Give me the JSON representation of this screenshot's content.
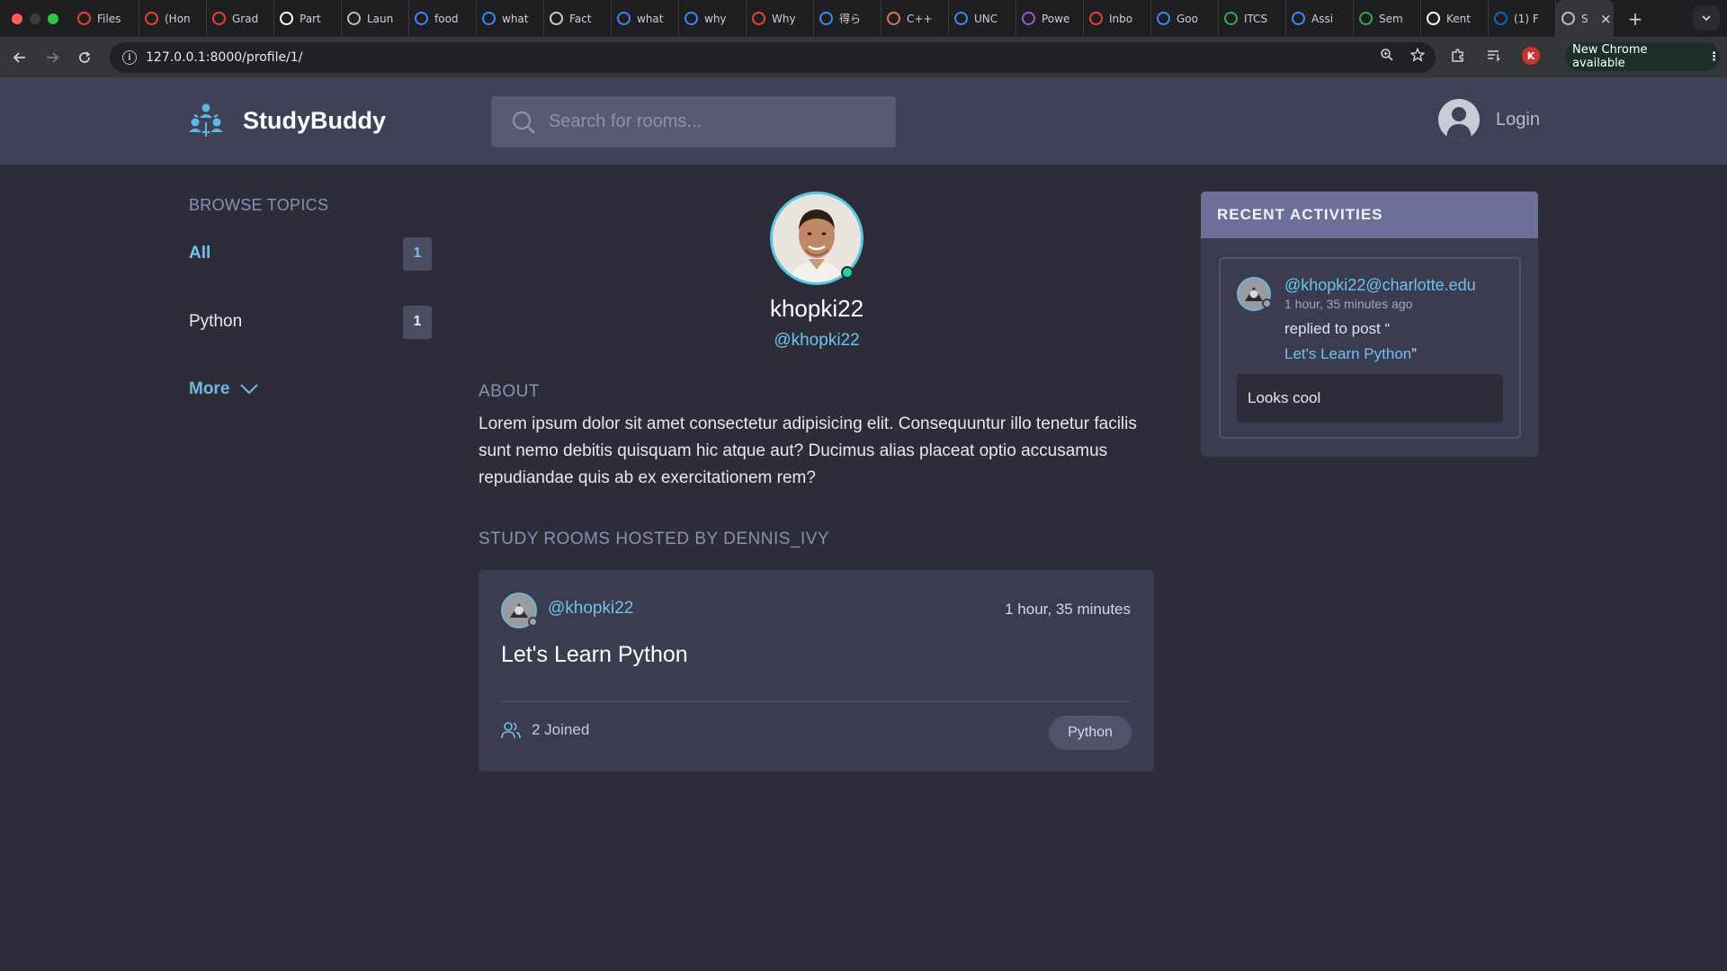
{
  "browser": {
    "tabs": [
      {
        "title": "Files",
        "icon": "loading-icon",
        "color": "#e94235"
      },
      {
        "title": "(Hon",
        "icon": "loading-icon",
        "color": "#e94235"
      },
      {
        "title": "Grad",
        "icon": "loading-icon",
        "color": "#e94235"
      },
      {
        "title": "Part",
        "icon": "github-icon",
        "color": "#ffffff"
      },
      {
        "title": "Laun",
        "icon": "globe-icon",
        "color": "#bdbdbd"
      },
      {
        "title": "food",
        "icon": "google-icon",
        "color": "#4285f4"
      },
      {
        "title": "what",
        "icon": "google-icon",
        "color": "#4285f4"
      },
      {
        "title": "Fact",
        "icon": "news-icon",
        "color": "#cccccc"
      },
      {
        "title": "what",
        "icon": "google-icon",
        "color": "#4285f4"
      },
      {
        "title": "why",
        "icon": "google-icon",
        "color": "#4285f4"
      },
      {
        "title": "Why",
        "icon": "star-icon",
        "color": "#e94235"
      },
      {
        "title": "得ら",
        "icon": "google-icon",
        "color": "#4285f4"
      },
      {
        "title": "C++",
        "icon": "claude-icon",
        "color": "#d97757"
      },
      {
        "title": "UNC",
        "icon": "calendar-icon",
        "color": "#4285f4"
      },
      {
        "title": "Powe",
        "icon": "copilot-icon",
        "color": "#9b59d0"
      },
      {
        "title": "Inbo",
        "icon": "gmail-icon",
        "color": "#ea4335"
      },
      {
        "title": "Goo",
        "icon": "translate-icon",
        "color": "#4285f4"
      },
      {
        "title": "ITCS",
        "icon": "drive-icon",
        "color": "#34a853"
      },
      {
        "title": "Assi",
        "icon": "docs-icon",
        "color": "#4285f4"
      },
      {
        "title": "Sem",
        "icon": "sheets-icon",
        "color": "#34a853"
      },
      {
        "title": "Kent",
        "icon": "github-icon",
        "color": "#ffffff"
      },
      {
        "title": "(1) F",
        "icon": "linkedin-icon",
        "color": "#0a66c2"
      }
    ],
    "active_tab": {
      "title": "S",
      "icon": "globe-icon"
    },
    "url": "127.0.0.1:8000/profile/1/",
    "profile_initial": "K",
    "update_label": "New Chrome available"
  },
  "header": {
    "brand": "StudyBuddy",
    "search_placeholder": "Search for rooms...",
    "login_label": "Login"
  },
  "sidebar": {
    "title": "BROWSE TOPICS",
    "topics": [
      {
        "name": "All",
        "count": "1"
      },
      {
        "name": "Python",
        "count": "1"
      }
    ],
    "more_label": "More"
  },
  "profile": {
    "name": "khopki22",
    "handle": "@khopki22",
    "about_label": "ABOUT",
    "about_text": "Lorem ipsum dolor sit amet consectetur adipisicing elit. Consequuntur illo tenetur facilis sunt nemo debitis quisquam hic atque aut? Ducimus alias placeat optio accusamus repudiandae quis ab ex exercitationem rem?",
    "rooms_label": "STUDY ROOMS HOSTED BY DENNIS_IVY"
  },
  "room": {
    "host": "@khopki22",
    "time": "1 hour, 35 minutes",
    "title": "Let's Learn Python",
    "joined": "2 Joined",
    "topic": "Python"
  },
  "activities": {
    "title": "RECENT ACTIVITIES",
    "items": [
      {
        "user": "@khopki22@charlotte.edu",
        "time": "1 hour, 35 minutes ago",
        "action_prefix": "replied to post “",
        "post_title": "Let's Learn Python",
        "action_suffix": "”",
        "reply": "Looks cool"
      }
    ]
  },
  "colors": {
    "accent": "#6fc3ea",
    "header_bg": "#3f4156",
    "page_bg": "#2d2d39",
    "card_bg": "#3b3c50",
    "online": "#21d49b"
  }
}
